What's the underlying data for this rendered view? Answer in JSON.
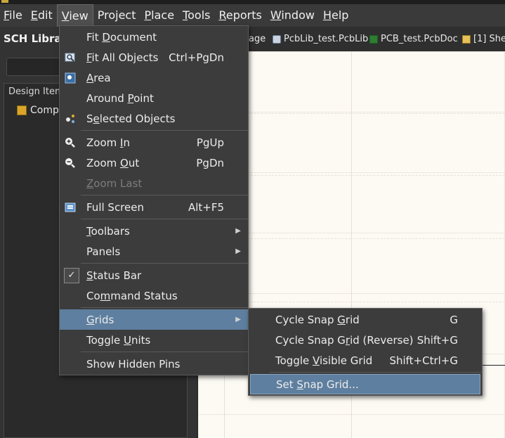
{
  "menubar": {
    "items": [
      {
        "label": "File",
        "accel": "F"
      },
      {
        "label": "Edit",
        "accel": "E"
      },
      {
        "label": "View",
        "accel": "V"
      },
      {
        "label": "Project",
        "accel": "j"
      },
      {
        "label": "Place",
        "accel": "P"
      },
      {
        "label": "Tools",
        "accel": "T"
      },
      {
        "label": "Reports",
        "accel": "R"
      },
      {
        "label": "Window",
        "accel": "W"
      },
      {
        "label": "Help",
        "accel": "H"
      }
    ]
  },
  "left_panel": {
    "title": "SCH Library",
    "tree_header": "Design Item",
    "tree_row": "Comp"
  },
  "doc_tabs": [
    {
      "label": "age",
      "icon": "page-icon"
    },
    {
      "label": "PcbLib_test.PcbLib",
      "icon": "pcblib-icon"
    },
    {
      "label": "PCB_test.PcbDoc",
      "icon": "pcbdoc-icon"
    },
    {
      "label": "[1] She",
      "icon": "sheet-icon"
    }
  ],
  "view_menu": {
    "fit_document": {
      "pre": "Fit ",
      "accel": "D",
      "post": "ocument",
      "shortcut": ""
    },
    "fit_all": {
      "pre": "",
      "accel": "F",
      "post": "it All Objects",
      "shortcut": "Ctrl+PgDn"
    },
    "area": {
      "pre": "",
      "accel": "A",
      "post": "rea",
      "shortcut": ""
    },
    "around_point": {
      "pre": "Around ",
      "accel": "P",
      "post": "oint",
      "shortcut": ""
    },
    "selected_objects": {
      "pre": "S",
      "accel": "e",
      "post": "lected Objects",
      "shortcut": ""
    },
    "zoom_in": {
      "pre": "Zoom ",
      "accel": "I",
      "post": "n",
      "shortcut": "PgUp"
    },
    "zoom_out": {
      "pre": "Zoom ",
      "accel": "O",
      "post": "ut",
      "shortcut": "PgDn"
    },
    "zoom_last": {
      "pre": "",
      "accel": "Z",
      "post": "oom Last",
      "shortcut": ""
    },
    "full_screen": {
      "pre": "Full Screen",
      "accel": "",
      "post": "",
      "shortcut": "Alt+F5"
    },
    "toolbars": {
      "pre": "",
      "accel": "T",
      "post": "oolbars"
    },
    "panels": {
      "pre": "Panels",
      "accel": "",
      "post": ""
    },
    "status_bar": {
      "pre": "",
      "accel": "S",
      "post": "tatus Bar",
      "checked": true
    },
    "command_status": {
      "pre": "Co",
      "accel": "m",
      "post": "mand Status"
    },
    "grids": {
      "pre": "",
      "accel": "G",
      "post": "rids"
    },
    "toggle_units": {
      "pre": "Toggle ",
      "accel": "U",
      "post": "nits"
    },
    "show_hidden_pins": {
      "pre": "Show Hidden Pins",
      "accel": "",
      "post": ""
    }
  },
  "grids_submenu": {
    "cycle_snap": {
      "pre": "Cycle Snap ",
      "accel": "G",
      "post": "rid",
      "shortcut": "G"
    },
    "cycle_snap_reverse": {
      "pre": "Cycle Snap G",
      "accel": "r",
      "post": "id (Reverse)",
      "shortcut": "Shift+G"
    },
    "toggle_visible": {
      "pre": "Toggle ",
      "accel": "V",
      "post": "isible Grid",
      "shortcut": "Shift+Ctrl+G"
    },
    "set_snap": {
      "pre": "Set ",
      "accel": "S",
      "post": "nap Grid...",
      "shortcut": ""
    }
  },
  "colors": {
    "highlight": "#5e7f9f",
    "menu_bg": "#3c3c3c",
    "canvas_bg": "#fdfaf4"
  }
}
